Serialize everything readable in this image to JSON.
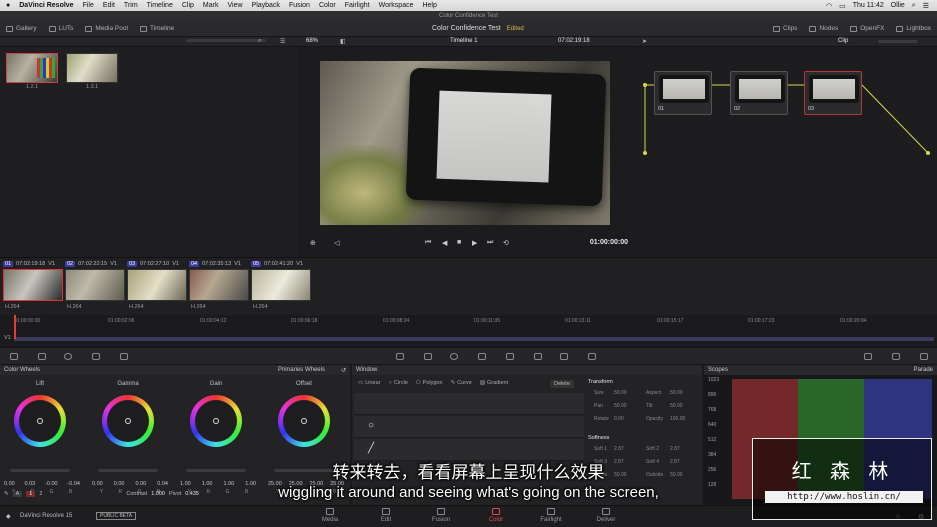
{
  "menubar": {
    "apple": "",
    "items": [
      "DaVinci Resolve",
      "File",
      "Edit",
      "Trim",
      "Timeline",
      "Clip",
      "Mark",
      "View",
      "Playback",
      "Fusion",
      "Color",
      "Fairlight",
      "Workspace",
      "Help"
    ],
    "clock": "Thu 11:42",
    "user": "Ollie"
  },
  "window_title": "Color Confidence Test",
  "toolbar": {
    "gallery": "Gallery",
    "luts": "LUTs",
    "media_pool": "Media Pool",
    "timeline": "Timeline",
    "project_title": "Color Confidence Test",
    "edited": "Edited",
    "clips": "Clips",
    "nodes": "Nodes",
    "openfx": "OpenFX",
    "lightbox": "Lightbox"
  },
  "subbar": {
    "zoom": "68%",
    "timeline_name": "Timeline 1",
    "timecode": "07:02:19:18",
    "clip_mode": "Clip"
  },
  "gallery": {
    "stills": [
      {
        "label": "1.2.1"
      },
      {
        "label": "1.3.1"
      }
    ]
  },
  "viewer": {
    "timecode": "01:00:00:00"
  },
  "nodes": [
    {
      "num": "01"
    },
    {
      "num": "02"
    },
    {
      "num": "03"
    }
  ],
  "clips": [
    {
      "num": "01",
      "tc": "07:02:19:18",
      "track": "V1",
      "codec": "H.264"
    },
    {
      "num": "02",
      "tc": "07:02:22:15",
      "track": "V1",
      "codec": "H.264"
    },
    {
      "num": "03",
      "tc": "07:02:27:10",
      "track": "V1",
      "codec": "H.264"
    },
    {
      "num": "04",
      "tc": "07:02:35:13",
      "track": "V1",
      "codec": "H.264"
    },
    {
      "num": "05",
      "tc": "07:02:41:20",
      "track": "V1",
      "codec": "H.264"
    }
  ],
  "mini_timeline": {
    "ticks": [
      "01:00:00:00",
      "01:00:02:06",
      "01:00:04:12",
      "01:00:06:18",
      "01:00:08:24",
      "01:00:11:05",
      "01:00:13:11",
      "01:00:15:17",
      "01:00:17:23",
      "01:00:20:04"
    ],
    "track": "V1"
  },
  "color_wheels": {
    "title": "Color Wheels",
    "mode": "Primaries Wheels",
    "wheels": [
      {
        "name": "Lift",
        "values": [
          "0.00",
          "0.03",
          "-0.00",
          "-0.04"
        ]
      },
      {
        "name": "Gamma",
        "values": [
          "0.00",
          "0.00",
          "0.00",
          "0.04"
        ]
      },
      {
        "name": "Gain",
        "values": [
          "1.00",
          "1.00",
          "1.00",
          "1.00"
        ]
      },
      {
        "name": "Offset",
        "values": [
          "25.00",
          "25.00",
          "25.00",
          "25.00"
        ]
      }
    ],
    "channels": [
      "Y",
      "R",
      "G",
      "B"
    ],
    "contrast_label": "Contrast",
    "contrast_value": "1.000",
    "pivot_label": "Pivot",
    "pivot_value": "0.435",
    "page_1": "1",
    "page_2": "2"
  },
  "window_panel": {
    "title": "Window",
    "tools": [
      "Linear",
      "Circle",
      "Polygon",
      "Curve",
      "Gradient"
    ],
    "delete": "Delete",
    "transform": "Transform",
    "transform_fields": [
      {
        "label": "Size",
        "value": "50.00"
      },
      {
        "label": "Aspect",
        "value": "50.00"
      },
      {
        "label": "Pan",
        "value": "50.00"
      },
      {
        "label": "Tilt",
        "value": "50.00"
      },
      {
        "label": "Rotate",
        "value": "0.00"
      },
      {
        "label": "Opacity",
        "value": "100.00"
      }
    ],
    "softness": "Softness",
    "softness_fields": [
      {
        "label": "Soft 1",
        "value": "2.87"
      },
      {
        "label": "Soft 2",
        "value": "2.87"
      },
      {
        "label": "Soft 3",
        "value": "2.87"
      },
      {
        "label": "Soft 4",
        "value": "2.87"
      },
      {
        "label": "Inside",
        "value": "50.00"
      },
      {
        "label": "Outside",
        "value": "50.00"
      }
    ]
  },
  "scopes": {
    "title": "Scopes",
    "mode": "Parade",
    "scale": [
      "1023",
      "896",
      "768",
      "640",
      "512",
      "384",
      "256",
      "128"
    ]
  },
  "pagebar": {
    "app_version": "DaVinci Resolve 15",
    "beta": "PUBLIC BETA",
    "tabs": [
      "Media",
      "Edit",
      "Fusion",
      "Color",
      "Fairlight",
      "Deliver"
    ],
    "active": "Color"
  },
  "subtitles": {
    "chinese": "转来转去，看看屏幕上呈现什么效果",
    "english": "wiggling it around and seeing what's going on the screen,"
  },
  "watermark": {
    "name": "红 森 林",
    "url": "http://www.hoslin.cn/"
  }
}
